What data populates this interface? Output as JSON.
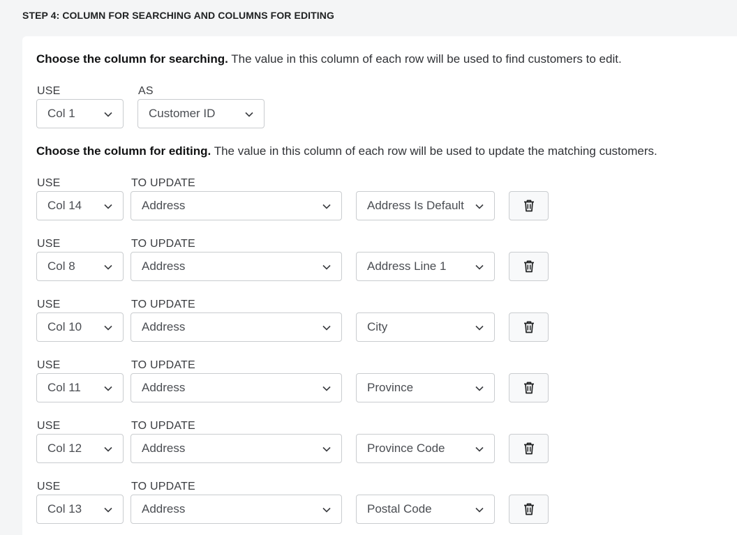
{
  "step": {
    "title": "STEP 4: COLUMN FOR SEARCHING AND COLUMNS FOR EDITING"
  },
  "search": {
    "heading_bold": "Choose the column for searching.",
    "heading_text": " The value in this column of each row will be used to find customers to edit.",
    "use_label": "USE",
    "as_label": "AS",
    "column": "Col 1",
    "field": "Customer ID"
  },
  "edit": {
    "heading_bold": "Choose the column for editing.",
    "heading_text": " The value in this column of each row will be used to update the matching customers.",
    "rows": [
      {
        "use_label": "USE",
        "update_label": "TO UPDATE",
        "column": "Col 14",
        "target": "Address",
        "property": "Address Is Default"
      },
      {
        "use_label": "USE",
        "update_label": "TO UPDATE",
        "column": "Col 8",
        "target": "Address",
        "property": "Address Line 1"
      },
      {
        "use_label": "USE",
        "update_label": "TO UPDATE",
        "column": "Col 10",
        "target": "Address",
        "property": "City"
      },
      {
        "use_label": "USE",
        "update_label": "TO UPDATE",
        "column": "Col 11",
        "target": "Address",
        "property": "Province"
      },
      {
        "use_label": "USE",
        "update_label": "TO UPDATE",
        "column": "Col 12",
        "target": "Address",
        "property": "Province Code"
      },
      {
        "use_label": "USE",
        "update_label": "TO UPDATE",
        "column": "Col 13",
        "target": "Address",
        "property": "Postal Code"
      }
    ]
  },
  "icons": {
    "dropdown": "chevron-down-icon",
    "delete": "trash-icon"
  },
  "colors": {
    "background": "#f4f5f6",
    "card": "#ffffff",
    "border": "#c9cccf",
    "text": "#202223"
  }
}
